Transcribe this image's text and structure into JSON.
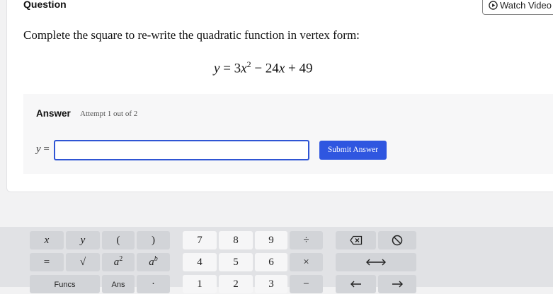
{
  "question": {
    "label": "Question",
    "watch_video_label": "Watch Video",
    "prompt": "Complete the square to re-write the quadratic function in vertex form:",
    "equation": {
      "lhs": "y",
      "eq": " = 3",
      "var1": "x",
      "exp": "2",
      "mid": " − 24",
      "var2": "x",
      "tail": " + 49"
    }
  },
  "answer": {
    "label": "Answer",
    "attempt": "Attempt 1 out of 2",
    "prefix_var": "y",
    "prefix_eq": " =",
    "input_value": "",
    "submit_label": "Submit Answer"
  },
  "keypad": {
    "row1": [
      "x",
      "y",
      "(",
      ")",
      "7",
      "8",
      "9",
      "÷"
    ],
    "row2": [
      "=",
      "√",
      "a",
      "2",
      "a",
      "b",
      "4",
      "5",
      "6",
      "×"
    ],
    "row3": [
      "Funcs",
      "Ans",
      "·",
      "1",
      "2",
      "3",
      "−"
    ],
    "icons": [
      "backspace-icon",
      "clear-icon",
      "left-right-arrow-icon",
      "left-arrow-icon",
      "right-arrow-icon"
    ]
  },
  "colors": {
    "accent": "#2f56e0",
    "keypad_bg": "#e1e2e5",
    "key_dark": "#d2d4d8",
    "key_light": "#f6f6f7"
  }
}
